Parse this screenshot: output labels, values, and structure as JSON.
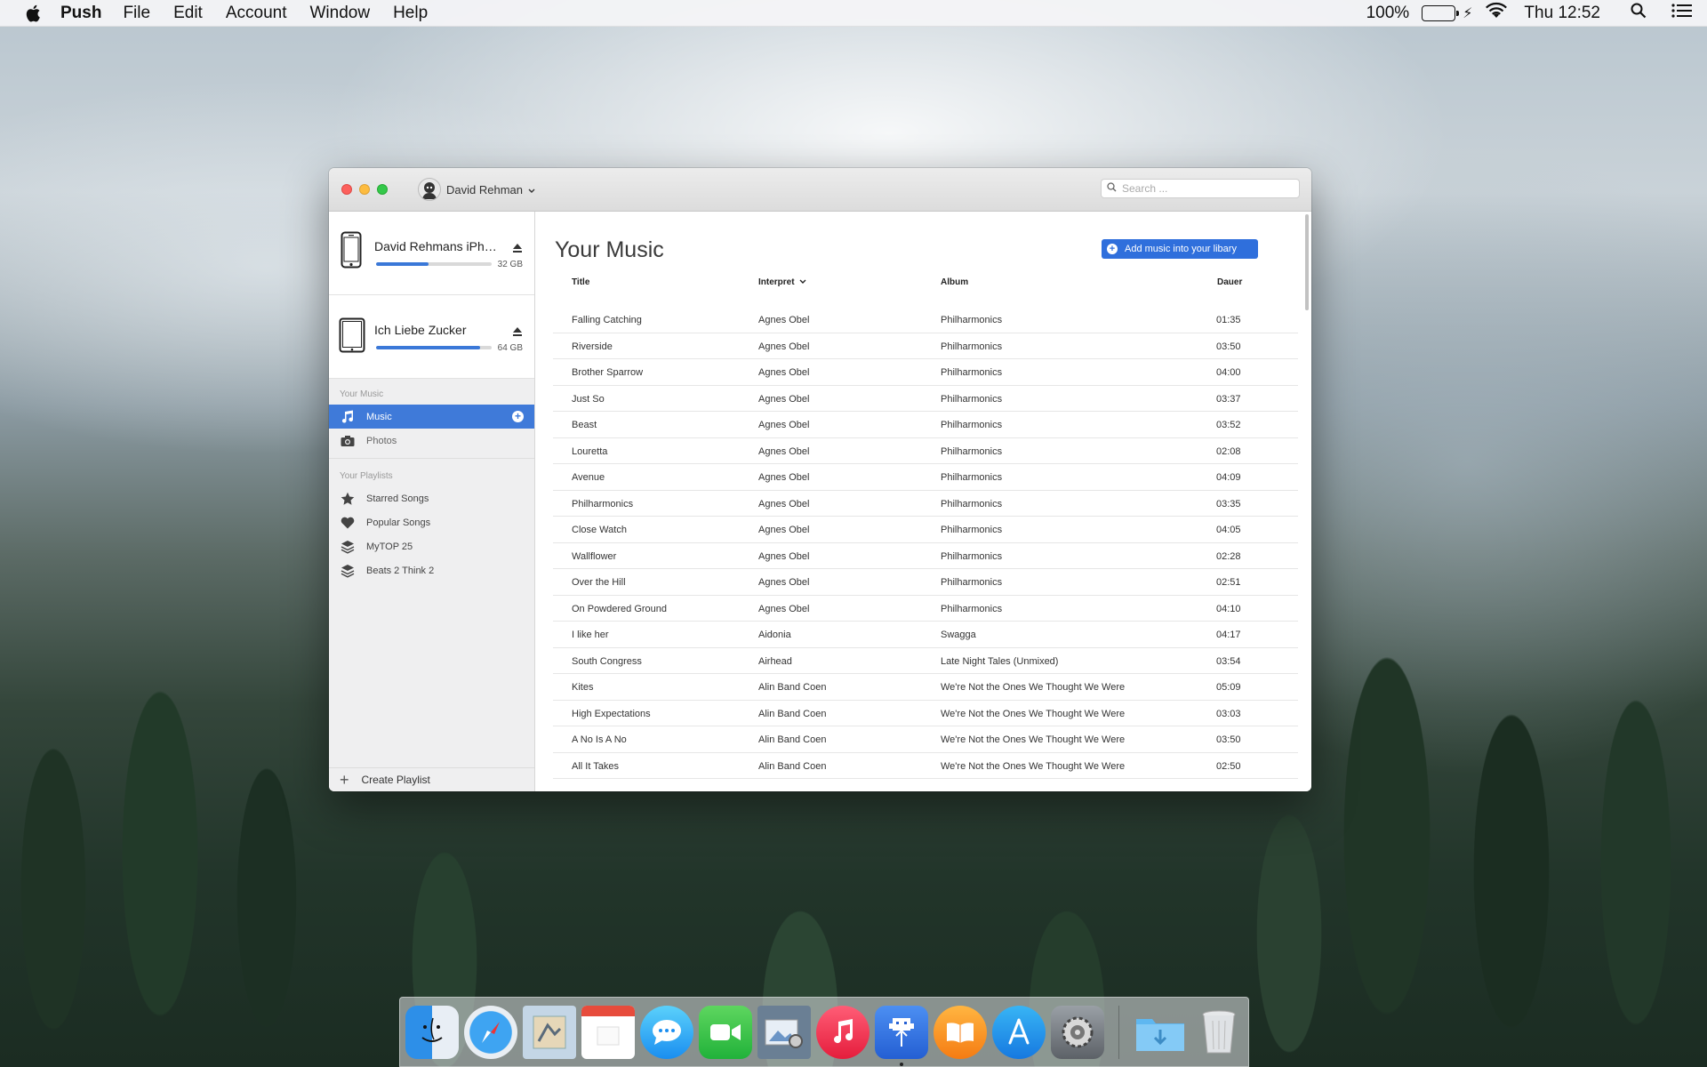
{
  "menubar": {
    "app_name": "Push",
    "menus": [
      "File",
      "Edit",
      "Account",
      "Window",
      "Help"
    ],
    "battery_percent": "100%",
    "clock": "Thu 12:52"
  },
  "window": {
    "account_name": "David Rehman",
    "search_placeholder": "Search ..."
  },
  "sidebar": {
    "devices": [
      {
        "name": "David Rehmans iPho...",
        "capacity": "32 GB",
        "used_fraction": 0.45,
        "type": "phone"
      },
      {
        "name": "Ich Liebe Zucker",
        "capacity": "64 GB",
        "used_fraction": 0.9,
        "type": "tablet"
      }
    ],
    "your_music_label": "Your Music",
    "library_items": [
      {
        "label": "Music",
        "icon": "music-note-icon",
        "active": true
      },
      {
        "label": "Photos",
        "icon": "camera-icon",
        "active": false
      }
    ],
    "playlists_label": "Your Playlists",
    "playlists": [
      {
        "label": "Starred Songs",
        "icon": "star-icon"
      },
      {
        "label": "Popular Songs",
        "icon": "heart-icon"
      },
      {
        "label": "MyTOP 25",
        "icon": "layers-icon"
      },
      {
        "label": "Beats 2 Think 2",
        "icon": "layers-icon"
      }
    ],
    "create_playlist": "Create Playlist"
  },
  "main": {
    "title": "Your Music",
    "add_button": "Add music into your libary",
    "columns": {
      "title": "Title",
      "interpret": "Interpret",
      "album": "Album",
      "dauer": "Dauer"
    },
    "songs": [
      {
        "title": "Falling Catching",
        "artist": "Agnes Obel",
        "album": "Philharmonics",
        "time": "01:35"
      },
      {
        "title": "Riverside",
        "artist": "Agnes Obel",
        "album": "Philharmonics",
        "time": "03:50"
      },
      {
        "title": "Brother Sparrow",
        "artist": "Agnes Obel",
        "album": "Philharmonics",
        "time": "04:00"
      },
      {
        "title": "Just So",
        "artist": "Agnes Obel",
        "album": "Philharmonics",
        "time": "03:37"
      },
      {
        "title": "Beast",
        "artist": "Agnes Obel",
        "album": "Philharmonics",
        "time": "03:52"
      },
      {
        "title": "Louretta",
        "artist": "Agnes Obel",
        "album": "Philharmonics",
        "time": "02:08"
      },
      {
        "title": "Avenue",
        "artist": "Agnes Obel",
        "album": "Philharmonics",
        "time": "04:09"
      },
      {
        "title": "Philharmonics",
        "artist": "Agnes Obel",
        "album": "Philharmonics",
        "time": "03:35"
      },
      {
        "title": "Close Watch",
        "artist": "Agnes Obel",
        "album": "Philharmonics",
        "time": "04:05"
      },
      {
        "title": "Wallflower",
        "artist": "Agnes Obel",
        "album": "Philharmonics",
        "time": "02:28"
      },
      {
        "title": "Over the Hill",
        "artist": "Agnes Obel",
        "album": "Philharmonics",
        "time": "02:51"
      },
      {
        "title": "On Powdered Ground",
        "artist": "Agnes Obel",
        "album": "Philharmonics",
        "time": "04:10"
      },
      {
        "title": "I like her",
        "artist": "Aidonia",
        "album": "Swagga",
        "time": "04:17"
      },
      {
        "title": "South Congress",
        "artist": "Airhead",
        "album": "Late Night Tales (Unmixed)",
        "time": "03:54"
      },
      {
        "title": "Kites",
        "artist": "Alin Band Coen",
        "album": "We're Not the Ones We Thought We Were",
        "time": "05:09"
      },
      {
        "title": "High Expectations",
        "artist": "Alin Band Coen",
        "album": "We're Not the Ones We Thought We Were",
        "time": "03:03"
      },
      {
        "title": "A No Is A No",
        "artist": "Alin Band Coen",
        "album": "We're Not the Ones We Thought We Were",
        "time": "03:50"
      },
      {
        "title": "All It Takes",
        "artist": "Alin Band Coen",
        "album": "We're Not the Ones We Thought We Were",
        "time": "02:50"
      }
    ]
  },
  "dock": {
    "apps": [
      "finder-icon",
      "safari-icon",
      "mail-icon",
      "calendar-icon",
      "messages-icon",
      "facetime-icon",
      "photos-icon",
      "itunes-icon",
      "push-app-icon",
      "ibooks-icon",
      "app-store-icon",
      "system-preferences-icon"
    ],
    "right": [
      "downloads-folder-icon",
      "trash-icon"
    ]
  },
  "colors": {
    "accent": "#3f7ad9",
    "button": "#2f6fdc"
  }
}
